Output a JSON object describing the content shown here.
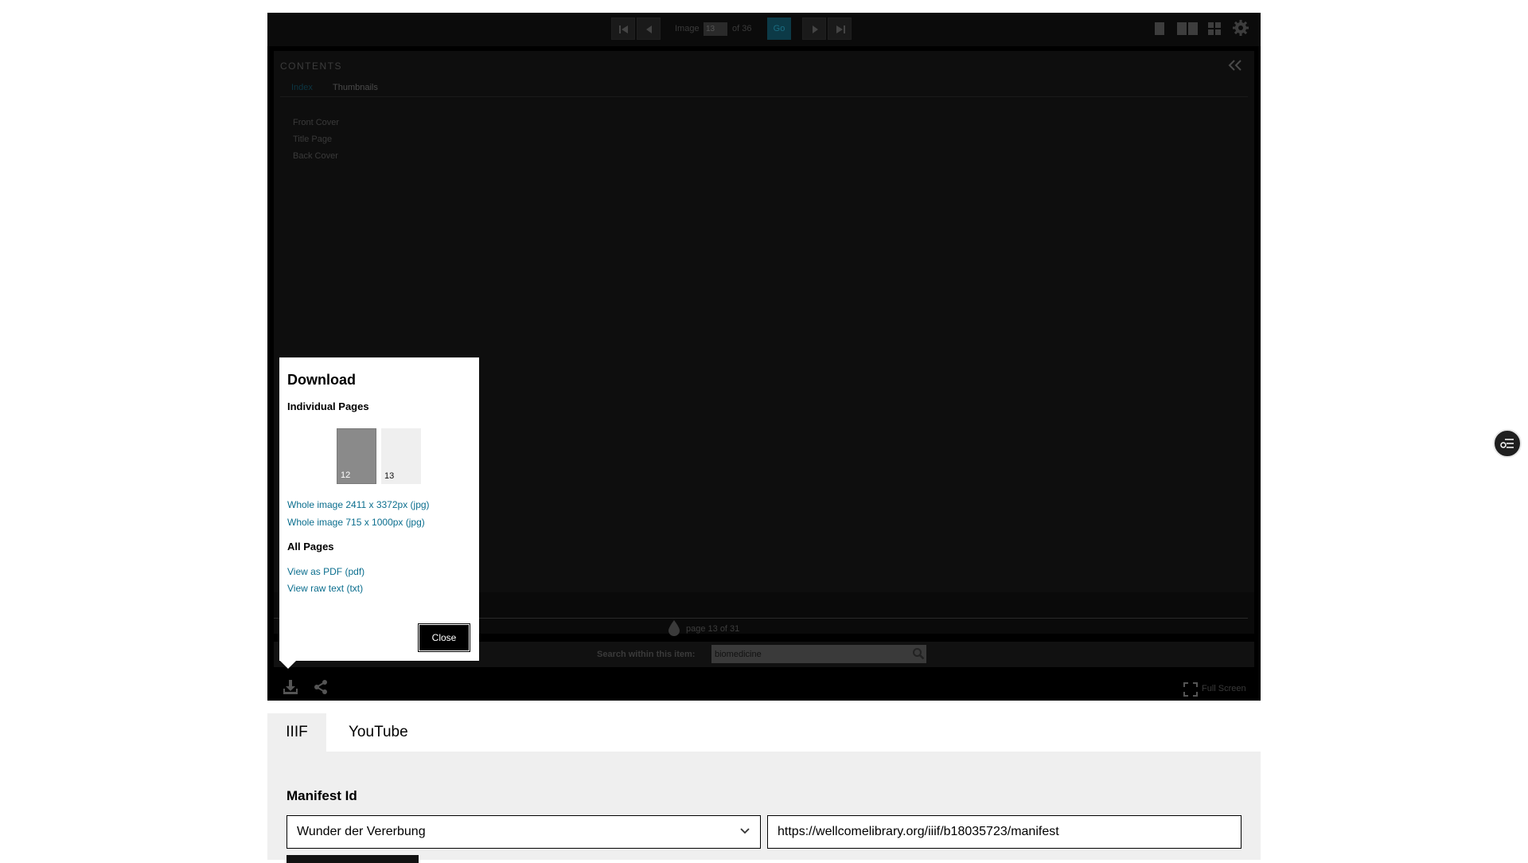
{
  "toolbar": {
    "image_label": "Image",
    "image_value": "13",
    "of_label": "of 36",
    "go_label": "Go"
  },
  "contents": {
    "title": "CONTENTS",
    "tabs": [
      "Index",
      "Thumbnails"
    ],
    "items": [
      "Front Cover",
      "Title Page",
      "Back Cover"
    ]
  },
  "progress": {
    "page_label": "page 13 of 31"
  },
  "search": {
    "label": "Search within this item:",
    "value": "biomedicine"
  },
  "footer": {
    "fullscreen_label": "Full Screen"
  },
  "download_dialog": {
    "title": "Download",
    "individual_heading": "Individual Pages",
    "thumbnails": [
      "12",
      "13"
    ],
    "links_individual": [
      "Whole image 2411 x 3372px (jpg)",
      "Whole image 715 x 1000px (jpg)"
    ],
    "all_heading": "All Pages",
    "links_all": [
      "View as PDF (pdf)",
      "View raw text (txt)"
    ],
    "close_label": "Close"
  },
  "lower": {
    "tabs": [
      "IIIF",
      "YouTube"
    ],
    "manifest_label": "Manifest Id",
    "selected_manifest": "Wunder der Vererbung",
    "manifest_url": "https://wellcomelibrary.org/iiif/b18035723/manifest"
  },
  "colors": {
    "viewer_bg": "#000000",
    "link": "#0b6e8e",
    "go_button": "#0c3a47",
    "panel_bg": "#efefef"
  }
}
